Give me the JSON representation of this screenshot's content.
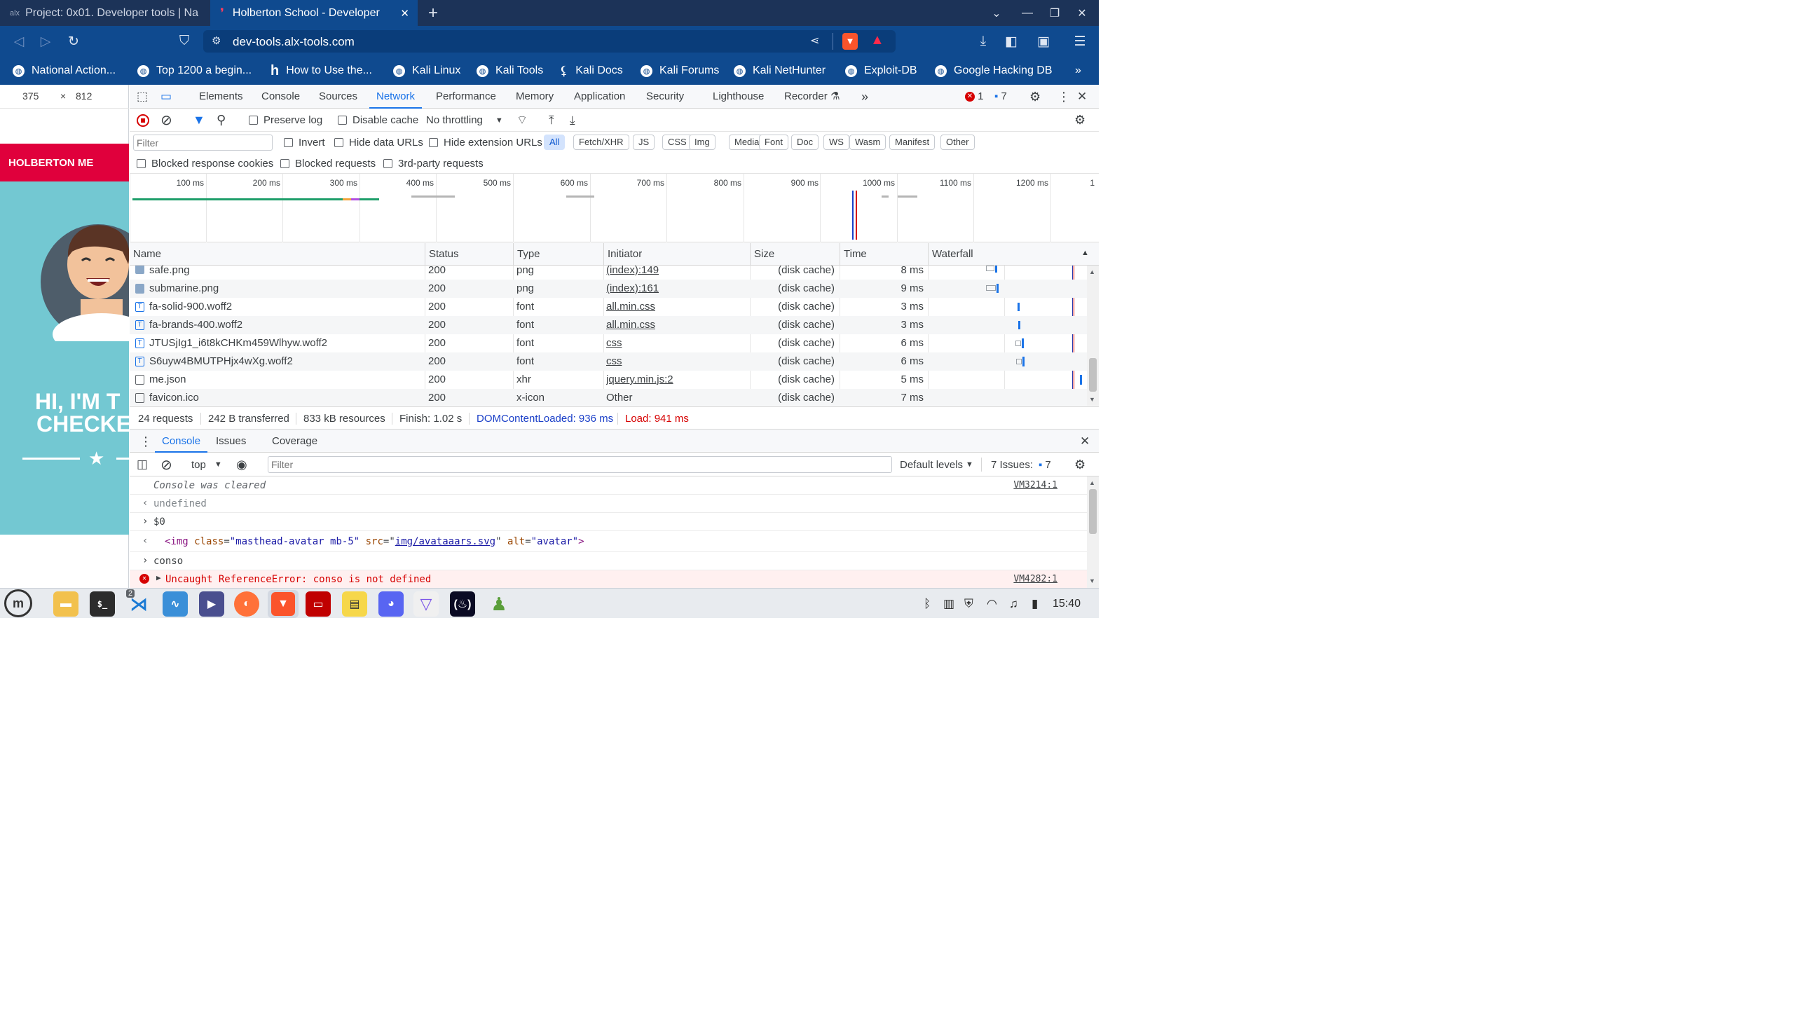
{
  "tabs": [
    {
      "title": "Project: 0x01. Developer tools | Na",
      "icon": "alx"
    },
    {
      "title": "Holberton School - Developer",
      "icon": "holberton-icon"
    }
  ],
  "address_bar": {
    "url": "dev-tools.alx-tools.com"
  },
  "bookmarks": [
    "National Action...",
    "Top 1200 a begin...",
    "How to Use the...",
    "Kali Linux",
    "Kali Tools",
    "Kali Docs",
    "Kali Forums",
    "Kali NetHunter",
    "Exploit-DB",
    "Google Hacking DB"
  ],
  "page_preview": {
    "width": "375",
    "times": "×",
    "height": "812",
    "banner": "HOLBERTON ME",
    "headline1": "HI, I'M T",
    "headline2": "CHECKE"
  },
  "devtools": {
    "tabs": [
      "Elements",
      "Console",
      "Sources",
      "Network",
      "Performance",
      "Memory",
      "Application",
      "Security",
      "Lighthouse",
      "Recorder"
    ],
    "more": "»",
    "errors_count": "1",
    "messages_count": "7",
    "network": {
      "preserve_log": "Preserve log",
      "disable_cache": "Disable cache",
      "throttling": "No throttling",
      "filter_placeholder": "Filter",
      "invert": "Invert",
      "hide_data_urls": "Hide data URLs",
      "hide_extension_urls": "Hide extension URLs",
      "type_filters": [
        "All",
        "Fetch/XHR",
        "JS",
        "CSS",
        "Img",
        "Media",
        "Font",
        "Doc",
        "WS",
        "Wasm",
        "Manifest",
        "Other"
      ],
      "blocked_response_cookies": "Blocked response cookies",
      "blocked_requests": "Blocked requests",
      "third_party": "3rd-party requests",
      "timeline_ticks": [
        "100 ms",
        "200 ms",
        "300 ms",
        "400 ms",
        "500 ms",
        "600 ms",
        "700 ms",
        "800 ms",
        "900 ms",
        "1000 ms",
        "1100 ms",
        "1200 ms",
        "1"
      ],
      "columns": [
        "Name",
        "Status",
        "Type",
        "Initiator",
        "Size",
        "Time",
        "Waterfall"
      ],
      "rows": [
        {
          "name": "safe.png",
          "status": "200",
          "type": "png",
          "initiator": "(index):149",
          "size": "(disk cache)",
          "time": "8 ms",
          "icon": "img"
        },
        {
          "name": "submarine.png",
          "status": "200",
          "type": "png",
          "initiator": "(index):161",
          "size": "(disk cache)",
          "time": "9 ms",
          "icon": "img"
        },
        {
          "name": "fa-solid-900.woff2",
          "status": "200",
          "type": "font",
          "initiator": "all.min.css",
          "size": "(disk cache)",
          "time": "3 ms",
          "icon": "font"
        },
        {
          "name": "fa-brands-400.woff2",
          "status": "200",
          "type": "font",
          "initiator": "all.min.css",
          "size": "(disk cache)",
          "time": "3 ms",
          "icon": "font"
        },
        {
          "name": "JTUSjIg1_i6t8kCHKm459Wlhyw.woff2",
          "status": "200",
          "type": "font",
          "initiator": "css",
          "size": "(disk cache)",
          "time": "6 ms",
          "icon": "font"
        },
        {
          "name": "S6uyw4BMUTPHjx4wXg.woff2",
          "status": "200",
          "type": "font",
          "initiator": "css",
          "size": "(disk cache)",
          "time": "6 ms",
          "icon": "font"
        },
        {
          "name": "me.json",
          "status": "200",
          "type": "xhr",
          "initiator": "jquery.min.js:2",
          "size": "(disk cache)",
          "time": "5 ms",
          "icon": "doc"
        },
        {
          "name": "favicon.ico",
          "status": "200",
          "type": "x-icon",
          "initiator": "Other",
          "size": "(disk cache)",
          "time": "7 ms",
          "icon": "doc"
        }
      ],
      "summary": {
        "requests": "24 requests",
        "transferred": "242 B transferred",
        "resources": "833 kB resources",
        "finish": "Finish: 1.02 s",
        "dom_loaded": "DOMContentLoaded: 936 ms",
        "load": "Load: 941 ms"
      }
    },
    "drawer": {
      "tabs": [
        "Console",
        "Issues",
        "Coverage"
      ],
      "context": "top",
      "filter_placeholder": "Filter",
      "levels": "Default levels",
      "issues_label": "7 Issues:",
      "issues_count": "7",
      "log": [
        {
          "kind": "info",
          "text": "Console was cleared",
          "source": "VM3214:1"
        },
        {
          "kind": "result",
          "text": "undefined"
        },
        {
          "kind": "input",
          "text": "$0"
        },
        {
          "kind": "result-html",
          "tag_open": "<img ",
          "attr1": "class",
          "val1": "\"masthead-avatar mb-5\"",
          "attr2": "src",
          "val2": "img/avataaars.svg",
          "attr3": "alt",
          "val3": "\"avatar\"",
          "tag_close": ">"
        },
        {
          "kind": "input",
          "text": "conso"
        },
        {
          "kind": "error",
          "text": "Uncaught ReferenceError: conso is not defined",
          "source": "VM4282:1"
        }
      ]
    }
  },
  "taskbar": {
    "clock": "15:40",
    "vscode_badge": "2"
  },
  "colors": {
    "accent": "#1a73e8",
    "error": "#d60000",
    "titlebar": "#1c3358",
    "toolbar": "#0f4a8f",
    "holberton_red": "#e0003c",
    "hero_teal": "#73c8d2"
  }
}
